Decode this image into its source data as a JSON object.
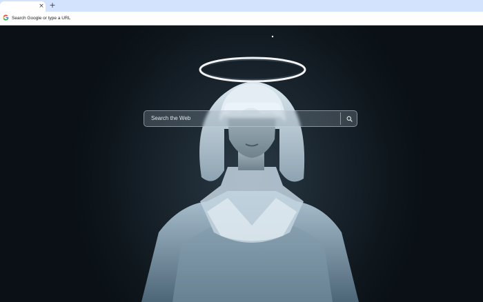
{
  "browser": {
    "tab": {
      "close_glyph": "×"
    },
    "new_tab_glyph": "+",
    "omnibox": {
      "placeholder": "Search Google or type a URL",
      "icon": "google-g-icon"
    }
  },
  "ntp": {
    "search": {
      "placeholder": "Search the Web",
      "button_icon": "search-icon"
    },
    "background": "anime-angel-wallpaper"
  }
}
